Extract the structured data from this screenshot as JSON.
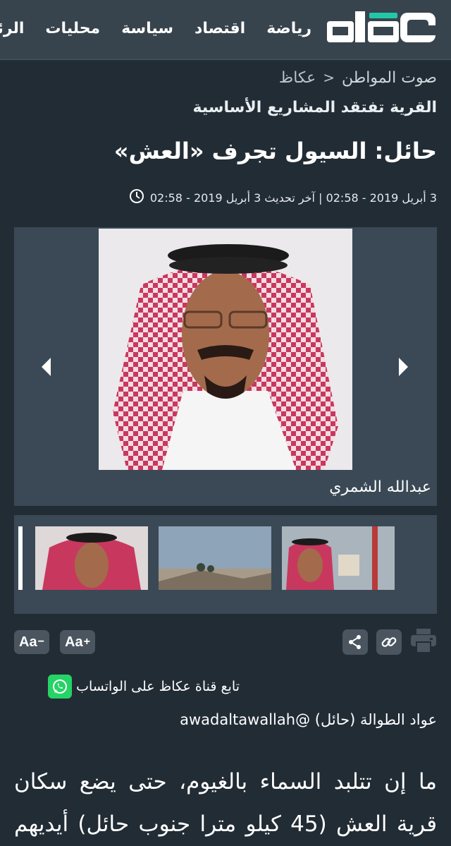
{
  "header": {
    "logo_text": "عكاظ",
    "nav": [
      "الرئيسية",
      "محليات",
      "سياسة",
      "اقتصاد",
      "رياضة"
    ]
  },
  "breadcrumb": {
    "home": "عكاظ",
    "separator": "<",
    "current": "صوت المواطن"
  },
  "article": {
    "subtitle": "القرية تفتقد المشاريع الأساسية",
    "title": "حائل: السيول تجرف «العش»",
    "date_text": "3 أبريل 2019 - 02:58 | آخر تحديث 3 أبريل 2019 - 02:58",
    "gallery_caption": "عبدالله الشمري",
    "author_name": "عواد الطوالة (حائل)",
    "author_handle": "@awadaltawallah",
    "body_lines": [
      "ما إن تتلبد السماء بالغيوم، حتى يضع سكان",
      "قرية العش (45 كيلو مترا جنوب حائل) أيديهم"
    ]
  },
  "tools": {
    "font_decrease": "Aa",
    "font_decrease_sign": "−",
    "font_increase": "Aa",
    "font_increase_sign": "+"
  },
  "whatsapp": {
    "label": "تابع قناة عكاظ على الواتساب"
  },
  "colors": {
    "background": "#222c35",
    "header": "#38444d",
    "gallery": "#3a4955",
    "button": "#4a5560",
    "whatsapp": "#25d366"
  },
  "icons": [
    "clock-icon",
    "chevron-left-icon",
    "chevron-right-icon",
    "share-icon",
    "link-icon",
    "print-icon",
    "whatsapp-icon"
  ]
}
